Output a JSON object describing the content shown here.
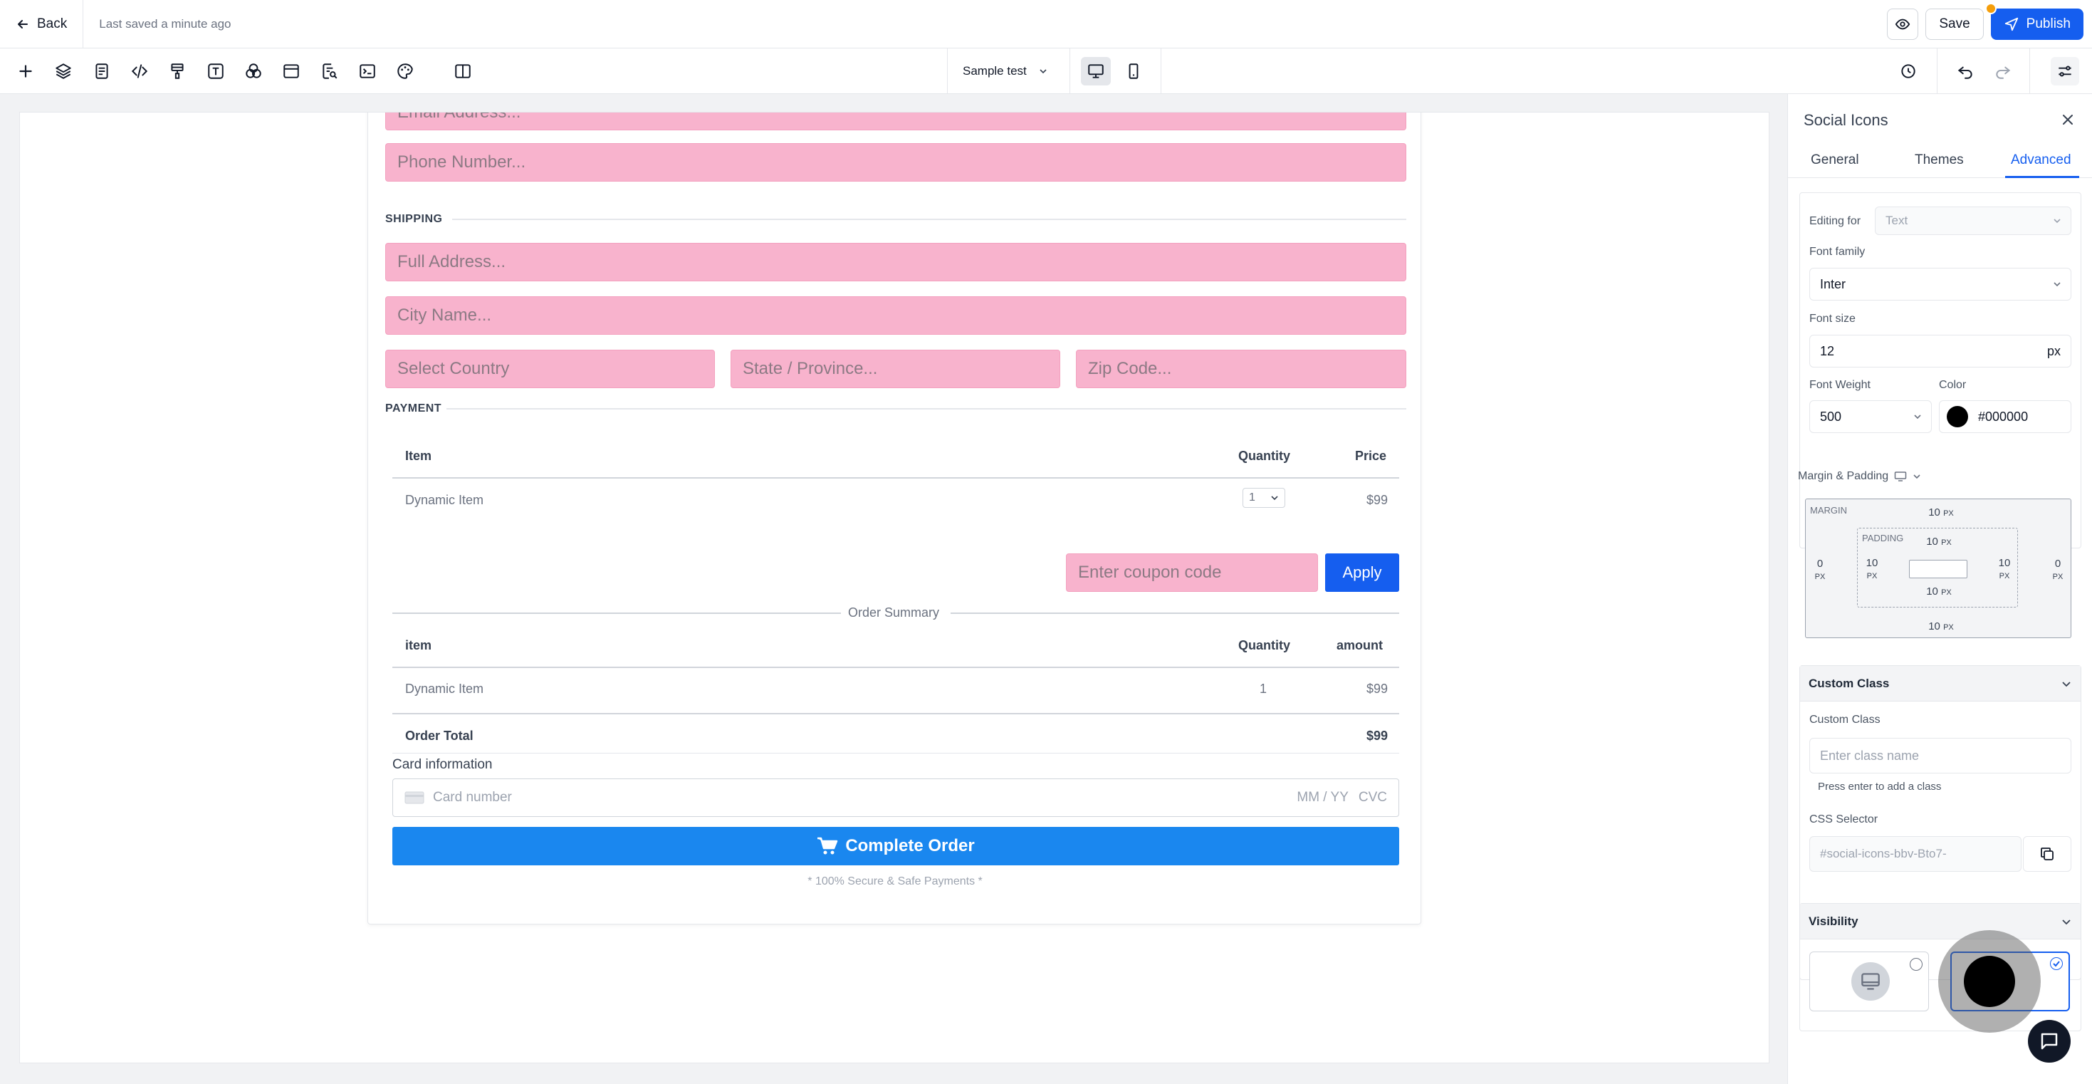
{
  "topbar": {
    "back_label": "Back",
    "saved_text": "Last saved a minute ago",
    "save_label": "Save",
    "publish_label": "Publish"
  },
  "toolbar": {
    "page_select_value": "Sample test",
    "icons": [
      "add-icon",
      "layers-icon",
      "pages-icon",
      "code-icon",
      "paint-icon",
      "text-icon",
      "shapes-icon",
      "layout-icon",
      "search-doc-icon",
      "terminal-icon",
      "palette-icon",
      "split-view-icon"
    ]
  },
  "form": {
    "email_placeholder": "Email Address...",
    "phone_placeholder": "Phone Number...",
    "shipping_label": "SHIPPING",
    "address_placeholder": "Full Address...",
    "city_placeholder": "City Name...",
    "country_placeholder": "Select Country",
    "state_placeholder": "State / Province...",
    "zip_placeholder": "Zip Code...",
    "payment_label": "PAYMENT",
    "items_table": {
      "headers": [
        "Item",
        "Quantity",
        "Price"
      ],
      "row": {
        "item": "Dynamic Item",
        "quantity": "1",
        "price": "$99"
      }
    },
    "coupon_placeholder": "Enter coupon code",
    "apply_label": "Apply",
    "order_summary_label": "Order Summary",
    "summary_table": {
      "headers": [
        "item",
        "Quantity",
        "amount"
      ],
      "row": {
        "item": "Dynamic Item",
        "quantity": "1",
        "amount": "$99"
      },
      "total_label": "Order Total",
      "total_value": "$99"
    },
    "card_info_label": "Card information",
    "card_number_placeholder": "Card number",
    "card_expiry_placeholder": "MM / YY",
    "card_cvc_placeholder": "CVC",
    "complete_order_label": "Complete Order",
    "secure_text": "* 100% Secure & Safe Payments *"
  },
  "panel": {
    "title": "Social Icons",
    "tabs": [
      "General",
      "Themes",
      "Advanced"
    ],
    "active_tab": "Advanced",
    "editing_for_label": "Editing for",
    "editing_for_value": "Text",
    "font_family_label": "Font family",
    "font_family_value": "Inter",
    "font_size_label": "Font size",
    "font_size_value": "12",
    "font_size_unit": "px",
    "font_weight_label": "Font Weight",
    "font_weight_value": "500",
    "color_label": "Color",
    "color_value": "#000000",
    "margin_padding_label": "Margin & Padding",
    "margin_label": "MARGIN",
    "padding_label": "PADDING",
    "margin": {
      "top": "10",
      "right": "0",
      "bottom": "10",
      "left": "0"
    },
    "padding": {
      "top": "10",
      "right": "10",
      "bottom": "10",
      "left": "10"
    },
    "unit": "PX",
    "custom_class_section": "Custom Class",
    "custom_class_label": "Custom Class",
    "custom_class_placeholder": "Enter class name",
    "custom_class_hint": "Press enter to add a class",
    "css_selector_label": "CSS Selector",
    "css_selector_value": "#social-icons-bbv-Bto7-",
    "visibility_section": "Visibility"
  },
  "colors": {
    "accent": "#155eef",
    "pink_field": "#f8b3cd",
    "complete_button": "#1a87ef",
    "notification_dot": "#f59e0b"
  }
}
